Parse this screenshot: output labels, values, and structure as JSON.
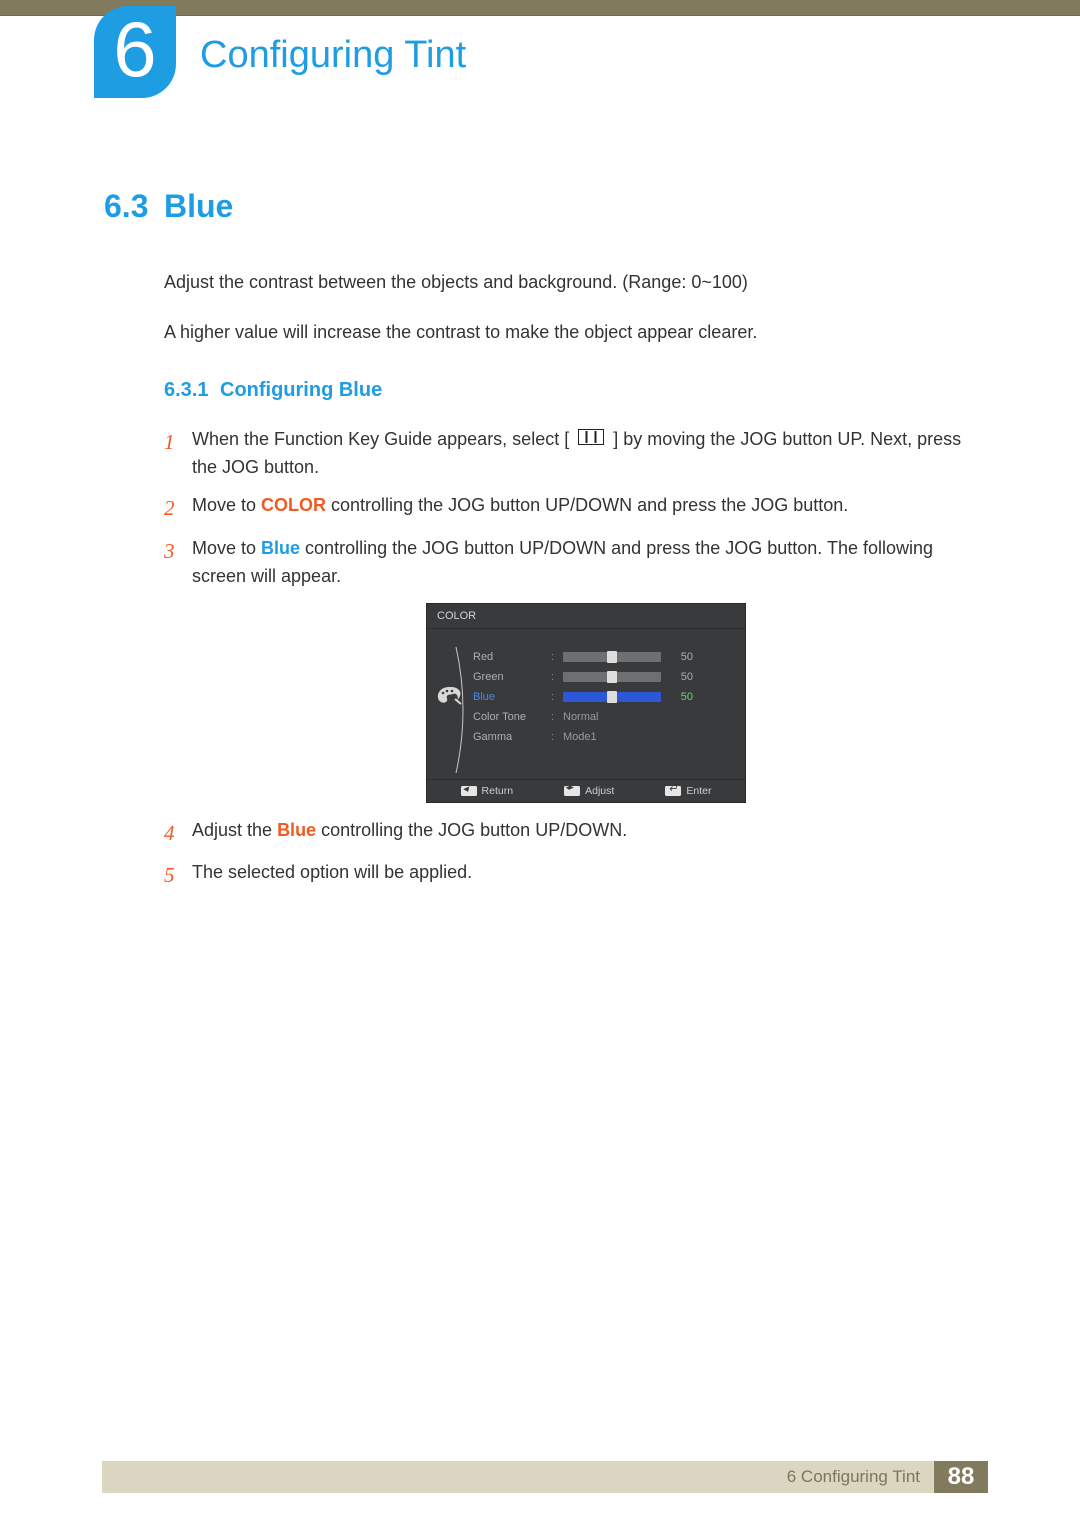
{
  "chapter": {
    "number": "6",
    "title": "Configuring Tint"
  },
  "section": {
    "number": "6.3",
    "title": "Blue",
    "intro1": "Adjust the contrast between the objects and background. (Range: 0~100)",
    "intro2": "A higher value will increase the contrast to make the object appear clearer."
  },
  "subsection": {
    "number": "6.3.1",
    "title": "Configuring Blue"
  },
  "steps": {
    "s1a": "When the Function Key Guide appears, select ",
    "s1b": " by moving the JOG button UP. Next, press the JOG button.",
    "s2a": "Move to ",
    "s2_color": "COLOR",
    "s2b": " controlling the JOG button UP/DOWN and press the JOG button.",
    "s3a": "Move to ",
    "s3_blue": "Blue",
    "s3b": " controlling the JOG button UP/DOWN and press the JOG button. The following screen will appear.",
    "s4a": "Adjust the ",
    "s4_blue": "Blue",
    "s4b": " controlling the JOG button UP/DOWN.",
    "s5": "The selected option will be applied."
  },
  "osd": {
    "header": "COLOR",
    "rows": {
      "red": {
        "label": "Red",
        "value": "50"
      },
      "green": {
        "label": "Green",
        "value": "50"
      },
      "blue": {
        "label": "Blue",
        "value": "50"
      },
      "tone": {
        "label": "Color Tone",
        "value": "Normal"
      },
      "gamma": {
        "label": "Gamma",
        "value": "Mode1"
      }
    },
    "footer": {
      "return": "Return",
      "adjust": "Adjust",
      "enter": "Enter"
    }
  },
  "footer": {
    "label": "6 Configuring Tint",
    "page": "88"
  }
}
